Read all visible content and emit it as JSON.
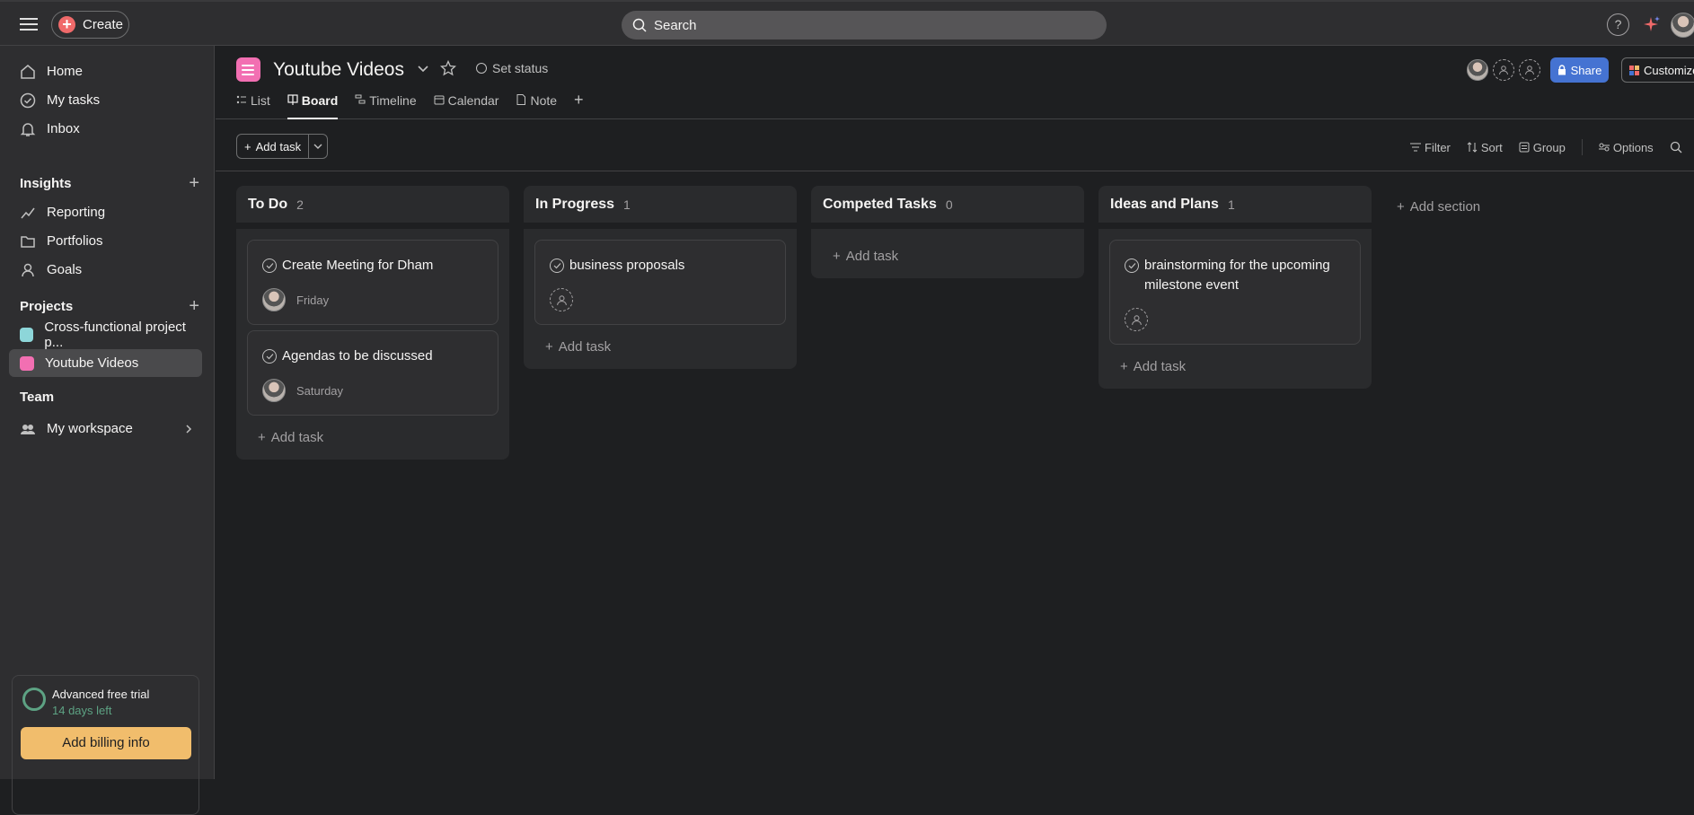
{
  "topbar": {
    "create_label": "Create",
    "search_placeholder": "Search",
    "help_label": "?"
  },
  "sidebar": {
    "nav": [
      {
        "label": "Home",
        "icon": "home-icon"
      },
      {
        "label": "My tasks",
        "icon": "check-circle-icon"
      },
      {
        "label": "Inbox",
        "icon": "bell-icon"
      }
    ],
    "insights_heading": "Insights",
    "insights": [
      {
        "label": "Reporting",
        "icon": "chart-line-icon"
      },
      {
        "label": "Portfolios",
        "icon": "folder-icon"
      },
      {
        "label": "Goals",
        "icon": "person-icon"
      }
    ],
    "projects_heading": "Projects",
    "projects": [
      {
        "label": "Cross-functional project p...",
        "color": "#8dd6d9"
      },
      {
        "label": "Youtube Videos",
        "color": "#f26fb2"
      }
    ],
    "team_heading": "Team",
    "team": [
      {
        "label": "My workspace",
        "icon": "people-icon"
      }
    ],
    "trial": {
      "title": "Advanced free trial",
      "days_left": "14 days left",
      "billing_button": "Add billing info"
    }
  },
  "header": {
    "project_title": "Youtube Videos",
    "set_status": "Set status",
    "tabs": [
      {
        "label": "List"
      },
      {
        "label": "Board"
      },
      {
        "label": "Timeline"
      },
      {
        "label": "Calendar"
      },
      {
        "label": "Note"
      }
    ],
    "share_label": "Share",
    "customize_label": "Customize"
  },
  "toolbar": {
    "add_task_label": "Add task",
    "filter_label": "Filter",
    "sort_label": "Sort",
    "group_label": "Group",
    "options_label": "Options"
  },
  "board": {
    "add_task_label": "Add task",
    "add_section_label": "Add section",
    "columns": [
      {
        "title": "To Do",
        "count": "2",
        "cards": [
          {
            "title": "Create Meeting for Dham",
            "due": "Friday"
          },
          {
            "title": "Agendas to be discussed",
            "due": "Saturday"
          }
        ]
      },
      {
        "title": "In Progress",
        "count": "1",
        "cards": [
          {
            "title": "business proposals"
          }
        ]
      },
      {
        "title": "Competed Tasks",
        "count": "0",
        "cards": []
      },
      {
        "title": "Ideas and Plans",
        "count": "1",
        "cards": [
          {
            "title": "brainstorming for the upcoming milestone event"
          }
        ]
      }
    ]
  },
  "colors": {
    "background": "#1e1f21",
    "sidebar": "#2e2e30",
    "accent_create": "#f06a6a",
    "share": "#4573d2",
    "billing": "#f1bd6c",
    "project_pink": "#f26fb2"
  }
}
